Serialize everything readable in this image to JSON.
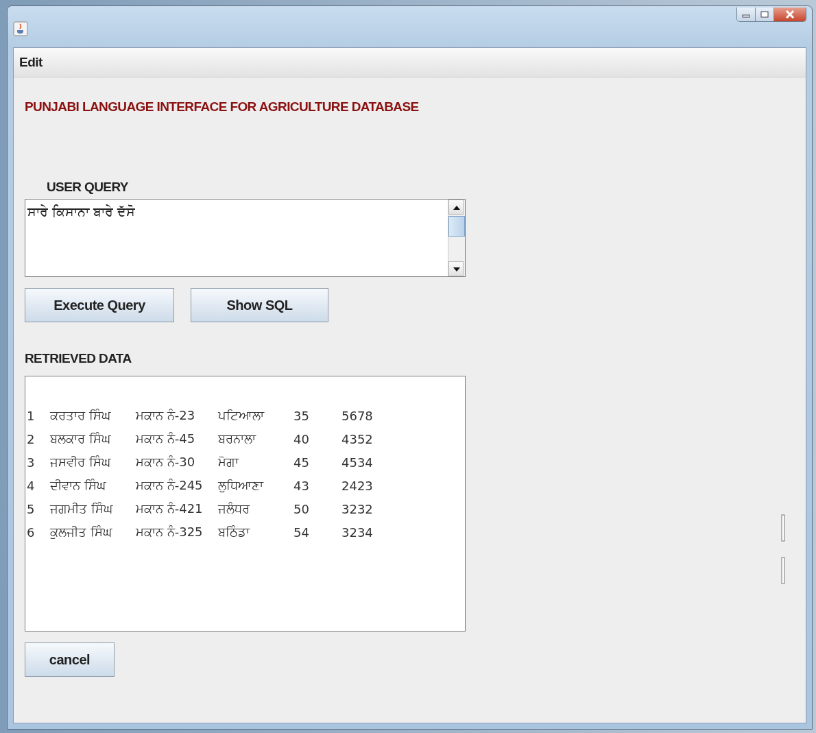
{
  "menu": [
    "Edit"
  ],
  "heading": "PUNJABI LANGUAGE INTERFACE FOR AGRICULTURE DATABASE",
  "query": {
    "label": "USER QUERY",
    "value": "ਸਾਰੇ ਕਿਸਾਨਾ ਬਾਰੇ ਦੱਸੋ"
  },
  "buttons": [
    "Execute Query",
    "Show SQL"
  ],
  "results": {
    "label": "RETRIEVED DATA",
    "rows": [
      [
        "1",
        "ਕਰਤਾਰ ਸਿੰਘ",
        "ਮਕਾਨ ਨੰ-23",
        "ਪਟਿਆਲਾ",
        "35",
        "5678"
      ],
      [
        "2",
        "ਬਲਕਾਰ ਸਿੰਘ",
        "ਮਕਾਨ ਨੰ-45",
        "ਬਰਨਾਲਾ",
        "40",
        "4352"
      ],
      [
        "3",
        "ਜਸਵੀਰ ਸਿੰਘ",
        "ਮਕਾਨ ਨੰ-30",
        "ਮੋਗਾ",
        "45",
        "4534"
      ],
      [
        "4",
        "ਦੀਵਾਨ ਸਿੰਘ",
        "ਮਕਾਨ ਨੰ-245",
        "ਲੁਧਿਆਣਾ",
        "43",
        "2423"
      ],
      [
        "5",
        "ਜਗਮੀਤ ਸਿੰਘ",
        "ਮਕਾਨ ਨੰ-421",
        "ਜਲੰਧਰ",
        "50",
        "3232"
      ],
      [
        "6",
        "ਕੁਲਜੀਤ ਸਿੰਘ",
        "ਮਕਾਨ ਨੰ-325",
        "ਬਠਿੰਡਾ",
        "54",
        "3234"
      ]
    ]
  },
  "cancel": "cancel"
}
